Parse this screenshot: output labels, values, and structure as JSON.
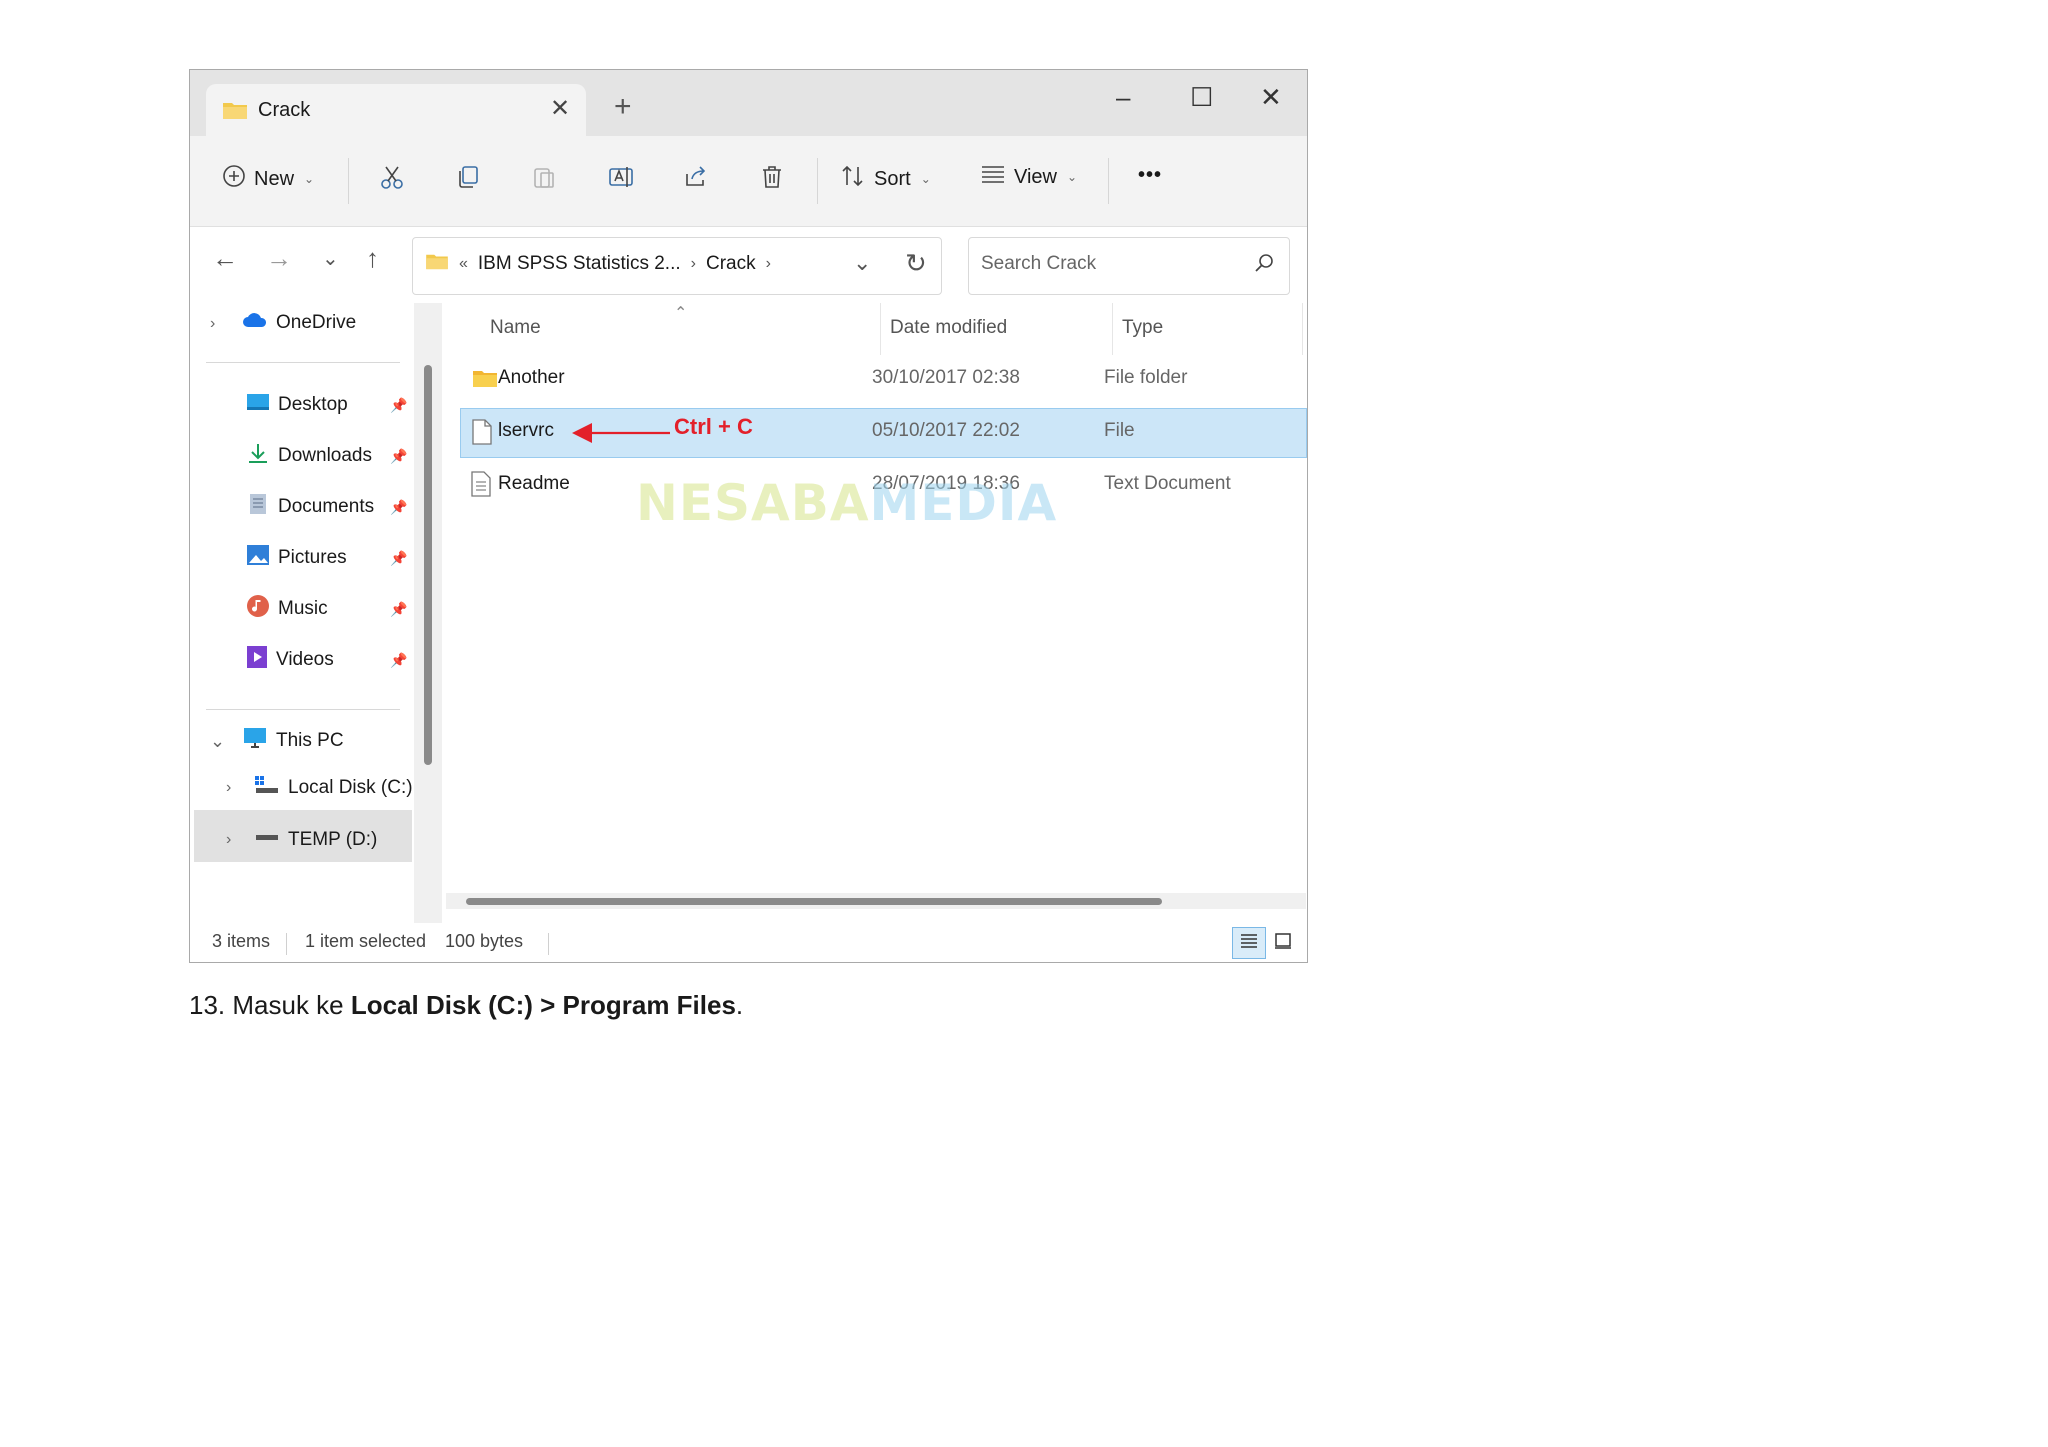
{
  "window": {
    "tab_title": "Crack",
    "new_tab": "+",
    "controls": {
      "minimize": "–",
      "maximize": "☐",
      "close": "✕"
    }
  },
  "toolbar": {
    "new_label": "New",
    "sort_label": "Sort",
    "view_label": "View",
    "more_label": "•••"
  },
  "address": {
    "prefix": "«",
    "crumbs": [
      "IBM SPSS Statistics 2...",
      "Crack"
    ],
    "separator": "›"
  },
  "search": {
    "placeholder": "Search Crack"
  },
  "sidebar": {
    "onedrive": "OneDrive",
    "quick": [
      "Desktop",
      "Downloads",
      "Documents",
      "Pictures",
      "Music",
      "Videos"
    ],
    "this_pc": "This PC",
    "drives": [
      "Local Disk (C:)",
      "TEMP (D:)"
    ]
  },
  "columns": {
    "name": "Name",
    "date": "Date modified",
    "type": "Type"
  },
  "files": [
    {
      "name": "Another",
      "date": "30/10/2017 02:38",
      "type": "File folder",
      "icon": "folder-icon"
    },
    {
      "name": "lservrc",
      "date": "05/10/2017 22:02",
      "type": "File",
      "icon": "file-icon",
      "selected": true
    },
    {
      "name": "Readme",
      "date": "28/07/2019 18:36",
      "type": "Text Document",
      "icon": "text-doc-icon"
    }
  ],
  "status": {
    "count": "3 items",
    "selected": "1 item selected",
    "size": "100 bytes"
  },
  "annotation": {
    "text": "Ctrl + C",
    "color": "#e3202a"
  },
  "watermark": {
    "part1": "NESABA",
    "part2": "MEDIA"
  },
  "caption": {
    "prefix": "13. Masuk ke ",
    "bold": "Local Disk (C:) > Program Files",
    "suffix": "."
  }
}
